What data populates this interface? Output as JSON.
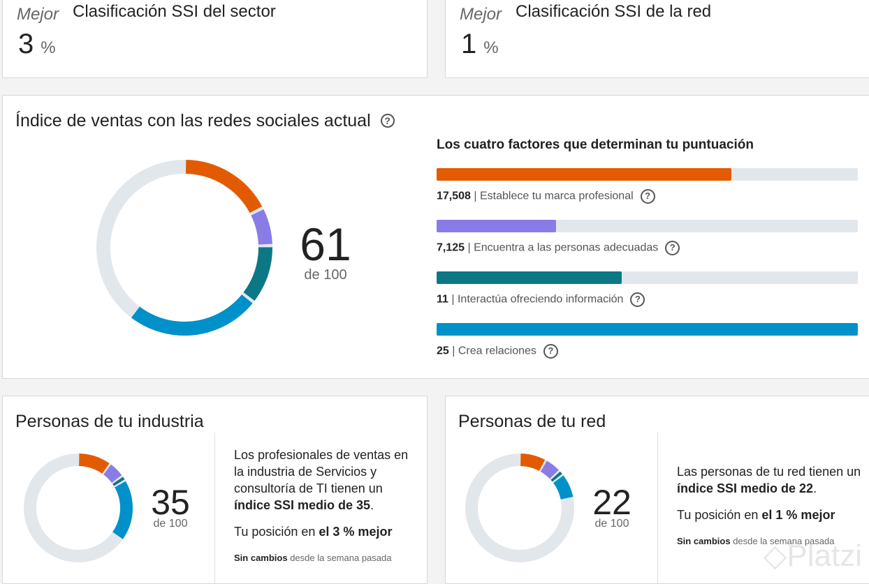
{
  "colors": {
    "orange": "#e35b00",
    "purple": "#8a7ce6",
    "teal": "#0c7886",
    "blue": "#0091ca",
    "track": "#e2e7ec"
  },
  "sector_rank": {
    "label": "Mejor",
    "title": "Clasificación SSI del sector",
    "value": "3",
    "unit": "%"
  },
  "network_rank": {
    "label": "Mejor",
    "title": "Clasificación SSI de la red",
    "value": "1",
    "unit": "%"
  },
  "current": {
    "title": "Índice de ventas con las redes sociales actual",
    "score": "61",
    "of": "de 100",
    "factors_title": "Los cuatro factores que determinan tu puntuación",
    "factors": [
      {
        "value": "17,508",
        "label": "Establece tu marca profesional",
        "score": 17.5,
        "color": "orange"
      },
      {
        "value": "7,125",
        "label": "Encuentra a las personas adecuadas",
        "score": 7.1,
        "color": "purple"
      },
      {
        "value": "11",
        "label": "Interactúa ofreciendo información",
        "score": 11,
        "color": "teal"
      },
      {
        "value": "25",
        "label": "Crea relaciones",
        "score": 25,
        "color": "blue"
      }
    ],
    "factor_max": 25
  },
  "industry": {
    "title": "Personas de tu industria",
    "score": "35",
    "of": "de 100",
    "segments": [
      10,
      5,
      1.5,
      18.5
    ],
    "text1": "Los profesionales de ventas en la industria de Servicios y consultoría de TI tienen un ",
    "text1_bold": "índice SSI medio de 35",
    "text1_end": ".",
    "text2": "Tu posición en ",
    "text2_bold": "el 3 % mejor",
    "change_bold": "Sin cambios",
    "change": " desde la semana pasada"
  },
  "network": {
    "title": "Personas de tu red",
    "score": "22",
    "of": "de 100",
    "segments": [
      8,
      5,
      1.5,
      7.5
    ],
    "text1": "Las personas de tu red tienen un ",
    "text1_bold": "índice SSI medio de 22",
    "text1_end": ".",
    "text2": "Tu posición en ",
    "text2_bold": "el 1 % mejor",
    "change_bold": "Sin cambios",
    "change": " desde la semana pasada"
  },
  "watermark": "Platzi"
}
